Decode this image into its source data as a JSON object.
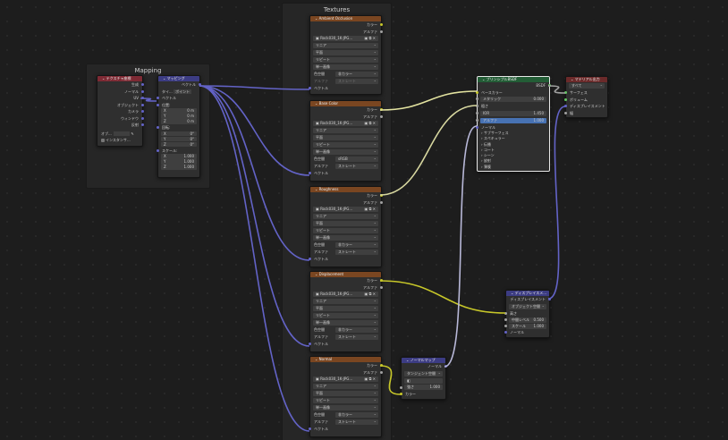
{
  "frames": {
    "mapping": "Mapping",
    "textures": "Textures"
  },
  "tex_coord": {
    "title": "テクスチャ座標",
    "outputs": [
      "生成",
      "ノーマル",
      "UV",
      "オブジェクト",
      "カメラ",
      "ウィンドウ",
      "反射"
    ],
    "object_label": "オブ...",
    "instancer_label": "インスタンサ..."
  },
  "mapping_node": {
    "title": "マッピング",
    "output": "ベクトル",
    "type_label": "タイ...",
    "type_value": "ポイント",
    "vector_in": "ベクトル",
    "location_label": "位置:",
    "location": [
      {
        "axis": "X",
        "value": "0 m"
      },
      {
        "axis": "Y",
        "value": "0 m"
      },
      {
        "axis": "Z",
        "value": "0 m"
      }
    ],
    "rotation_label": "回転:",
    "rotation": [
      {
        "axis": "X",
        "value": "0°"
      },
      {
        "axis": "Y",
        "value": "0°"
      },
      {
        "axis": "Z",
        "value": "0°"
      }
    ],
    "scale_label": "スケール:",
    "scale": [
      {
        "axis": "X",
        "value": "1.000"
      },
      {
        "axis": "Y",
        "value": "1.000"
      },
      {
        "axis": "Z",
        "value": "1.000"
      }
    ]
  },
  "textures": [
    {
      "title": "Ambient Occlusion",
      "image": "Rock030_1K-JPG...",
      "color_space": "",
      "alpha_mode": ""
    },
    {
      "title": "Base Color",
      "image": "Rock030_1K-JPG...",
      "color_space": "sRGB",
      "alpha_mode": "ストレート"
    },
    {
      "title": "Roughness",
      "image": "Rock030_1K-JPG...",
      "color_space": "非カラー",
      "alpha_mode": "ストレート"
    },
    {
      "title": "Displacement",
      "image": "Rock030_1K-JPG...",
      "color_space": "非カラー",
      "alpha_mode": "ストレート"
    },
    {
      "title": "Normal",
      "image": "Rock030_1K-JPG...",
      "color_space": "非カラー",
      "alpha_mode": "ストレート"
    }
  ],
  "tex_common": {
    "out_color": "カラー",
    "out_alpha": "アルファ",
    "interpolation": "リニア",
    "projection": "平面",
    "extension": "リピート",
    "source": "単一画像",
    "color_space_label": "色空間",
    "alpha_label": "アルファ",
    "vector_in": "ベクトル",
    "ao_alpha_value": "ストレート",
    "ao_color_space": "非カラー"
  },
  "bsdf": {
    "title": "プリンシプルBSDF",
    "output": "BSDF",
    "base_color": "ベースカラー",
    "metallic_label": "メタリック",
    "metallic_value": "0.000",
    "roughness_label": "粗さ",
    "ior_label": "IOR",
    "ior_value": "1.450",
    "alpha_label": "アルファ",
    "alpha_value": "1.000",
    "normal": "ノーマル",
    "panels": [
      "サブサーフェス",
      "スペキュラー",
      "伝播",
      "コート",
      "シーン",
      "放射",
      "薄膜"
    ]
  },
  "output_node": {
    "title": "マテリアル出力",
    "target": "すべて",
    "inputs": [
      "サーフェス",
      "ボリューム",
      "ディスプレイスメント",
      "幅"
    ]
  },
  "displacement": {
    "title": "ディスプレイスメ...",
    "output": "ディスプレイスメント",
    "space": "オブジェクト空間",
    "height_label": "高さ",
    "midlevel_label": "中間レベル",
    "midlevel_value": "0.500",
    "scale_label": "スケール",
    "scale_value": "1.000",
    "normal": "ノーマル"
  },
  "normal_map": {
    "title": "ノーマルマップ",
    "output": "ノーマル",
    "space": "タンジェント空間",
    "uv_label": "",
    "strength_label": "強さ",
    "strength_value": "1.000",
    "color_in": "カラー"
  },
  "colors": {
    "texture_header": "#7a4621",
    "vector_header": "#3c3c83",
    "shader_header": "#235d36",
    "link_vector": "#6363c7",
    "link_color": "#c7c729",
    "link_float": "#a1a1a1"
  }
}
